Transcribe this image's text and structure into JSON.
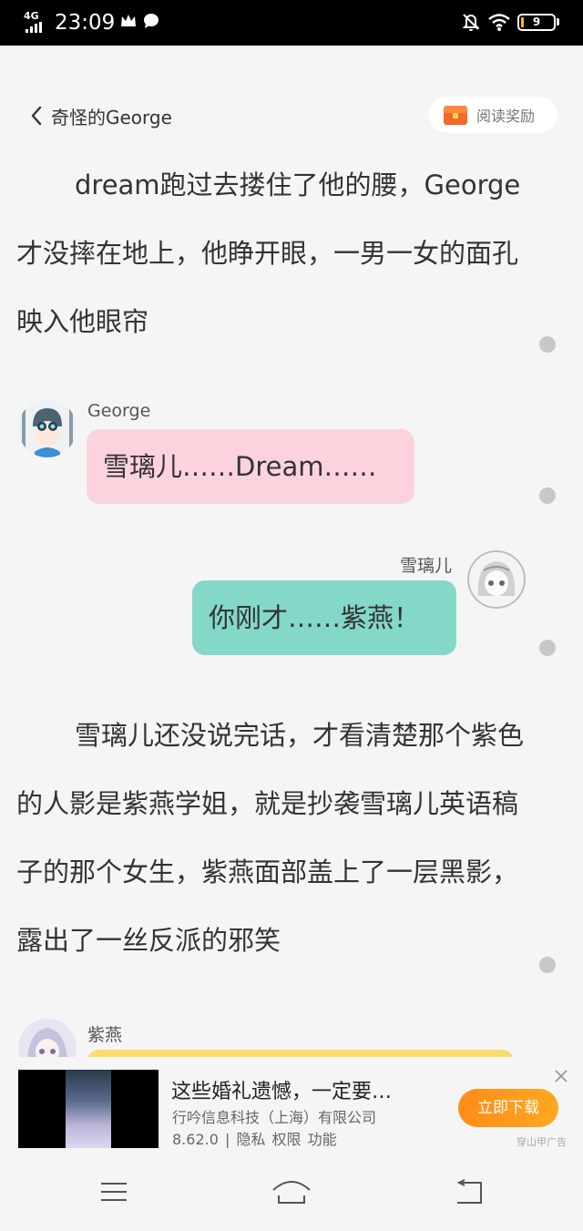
{
  "status_bar": {
    "network": "4G",
    "time": "23:09",
    "battery": "9",
    "battery_level": 0.09,
    "battery_color": "#f5c400"
  },
  "header": {
    "back_title": "奇怪的George",
    "reward_label": "阅读奖励"
  },
  "paragraphs": [
    "dream跑过去搂住了他的腰，George才没摔在地上，他睁开眼，一男一女的面孔映入他眼帘",
    "雪璃儿还没说完话，才看清楚那个紫色的人影是紫燕学姐，就是抄袭雪璃儿英语稿子的那个女生，紫燕面部盖上了一层黑影，露出了一丝反派的邪笑"
  ],
  "messages": [
    {
      "speaker": "George",
      "text": "雪璃儿……Dream……",
      "color": "#fcd3dd"
    },
    {
      "speaker": "雪璃儿",
      "text": "你刚才……紫燕！",
      "color": "#84d8c8"
    },
    {
      "speaker": "紫燕",
      "text": "",
      "color": "#f8de70"
    }
  ],
  "ad": {
    "title": "这些婚礼遗憾，一定要…",
    "company": "行吟信息科技（上海）有限公司",
    "meta": "8.62.0 | 隐私  权限  功能",
    "button": "立即下载",
    "tag": "穿山甲广告",
    "button_color": "#ff8c1a"
  },
  "icons": {
    "status": [
      "signal-icon",
      "crown-icon",
      "chat-icon",
      "mute-bell-icon",
      "wifi-icon",
      "battery-icon"
    ],
    "nav": [
      "menu-icon",
      "home-icon",
      "back-icon"
    ]
  }
}
